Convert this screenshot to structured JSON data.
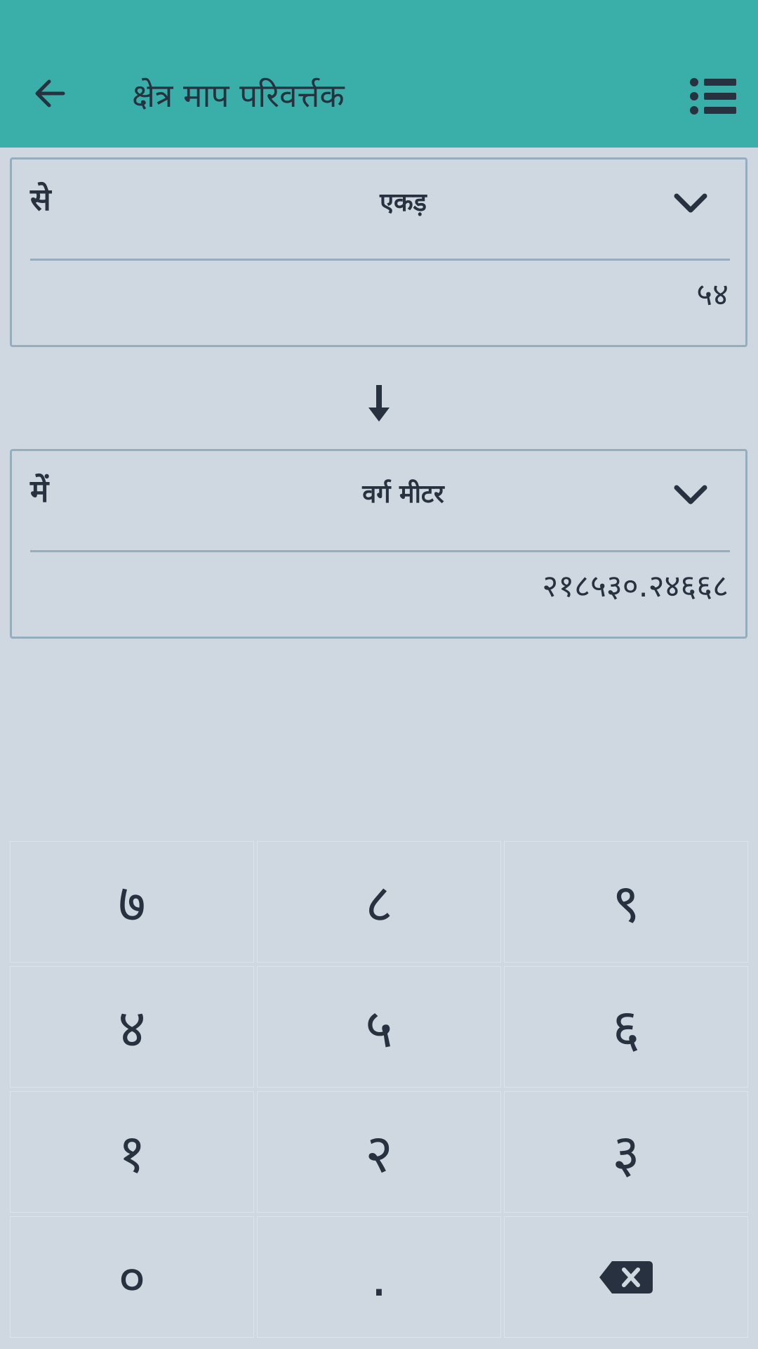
{
  "appbar": {
    "title": "क्षेत्र माप परिवर्त्तक",
    "back_icon": "arrow-left-icon",
    "menu_icon": "list-icon",
    "color": "#3aafa9"
  },
  "from": {
    "label": "से",
    "unit": "एकड़",
    "value": "५४"
  },
  "swap_icon": "arrow-down-icon",
  "to": {
    "label": "में",
    "unit": "वर्ग मीटर",
    "value": "२१८५३०.२४६६८"
  },
  "keypad": {
    "keys": [
      "७",
      "८",
      "९",
      "४",
      "५",
      "६",
      "१",
      "२",
      "३",
      "०",
      ".",
      ""
    ],
    "backspace_icon": "backspace-icon"
  }
}
